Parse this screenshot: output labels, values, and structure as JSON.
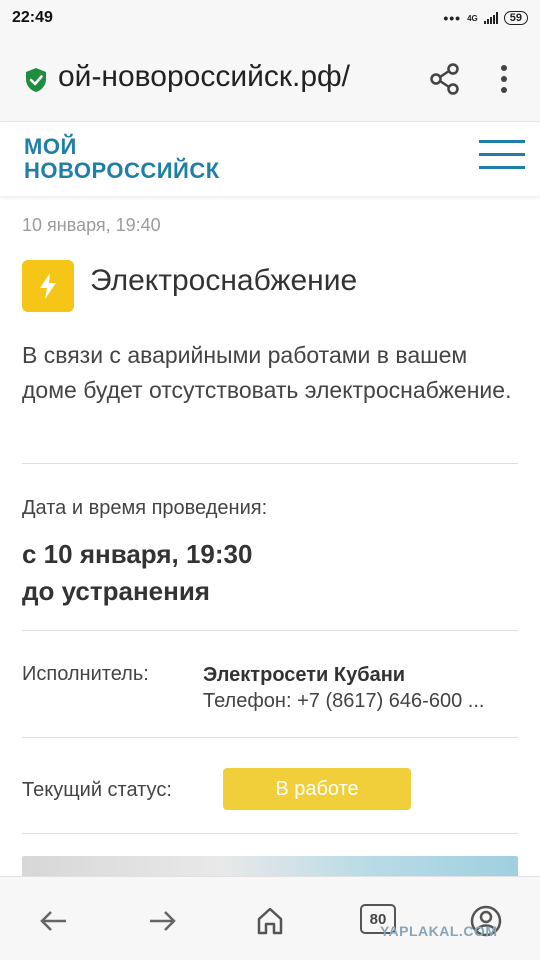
{
  "status_bar": {
    "time": "22:49",
    "network": "4G",
    "battery": "59"
  },
  "browser": {
    "url": "ой-новороссийск.рф/"
  },
  "site": {
    "logo_line1": "МОЙ",
    "logo_line2": "НОВОРОССИЙСК",
    "brand_color": "#1f7fa6"
  },
  "notice": {
    "date": "10 января, 19:40",
    "category": "Электроснабжение",
    "category_icon": "lightning-icon",
    "description": "В связи с аварийными работами в вашем доме будет отсутствовать электроснабжение.",
    "schedule_label": "Дата и время проведения:",
    "schedule_line1": "с 10 января, 19:30",
    "schedule_line2": "до устранения",
    "executor_label": "Исполнитель:",
    "executor_name": "Электросети Кубани",
    "executor_phone": "Телефон: +7 (8617) 646-600 ...",
    "status_label": "Текущий статус:",
    "status_value": "В работе",
    "status_color": "#f1cf3b"
  },
  "bottom_nav": {
    "tabs_count": "80",
    "watermark": "YAPLAKAL.COM"
  }
}
